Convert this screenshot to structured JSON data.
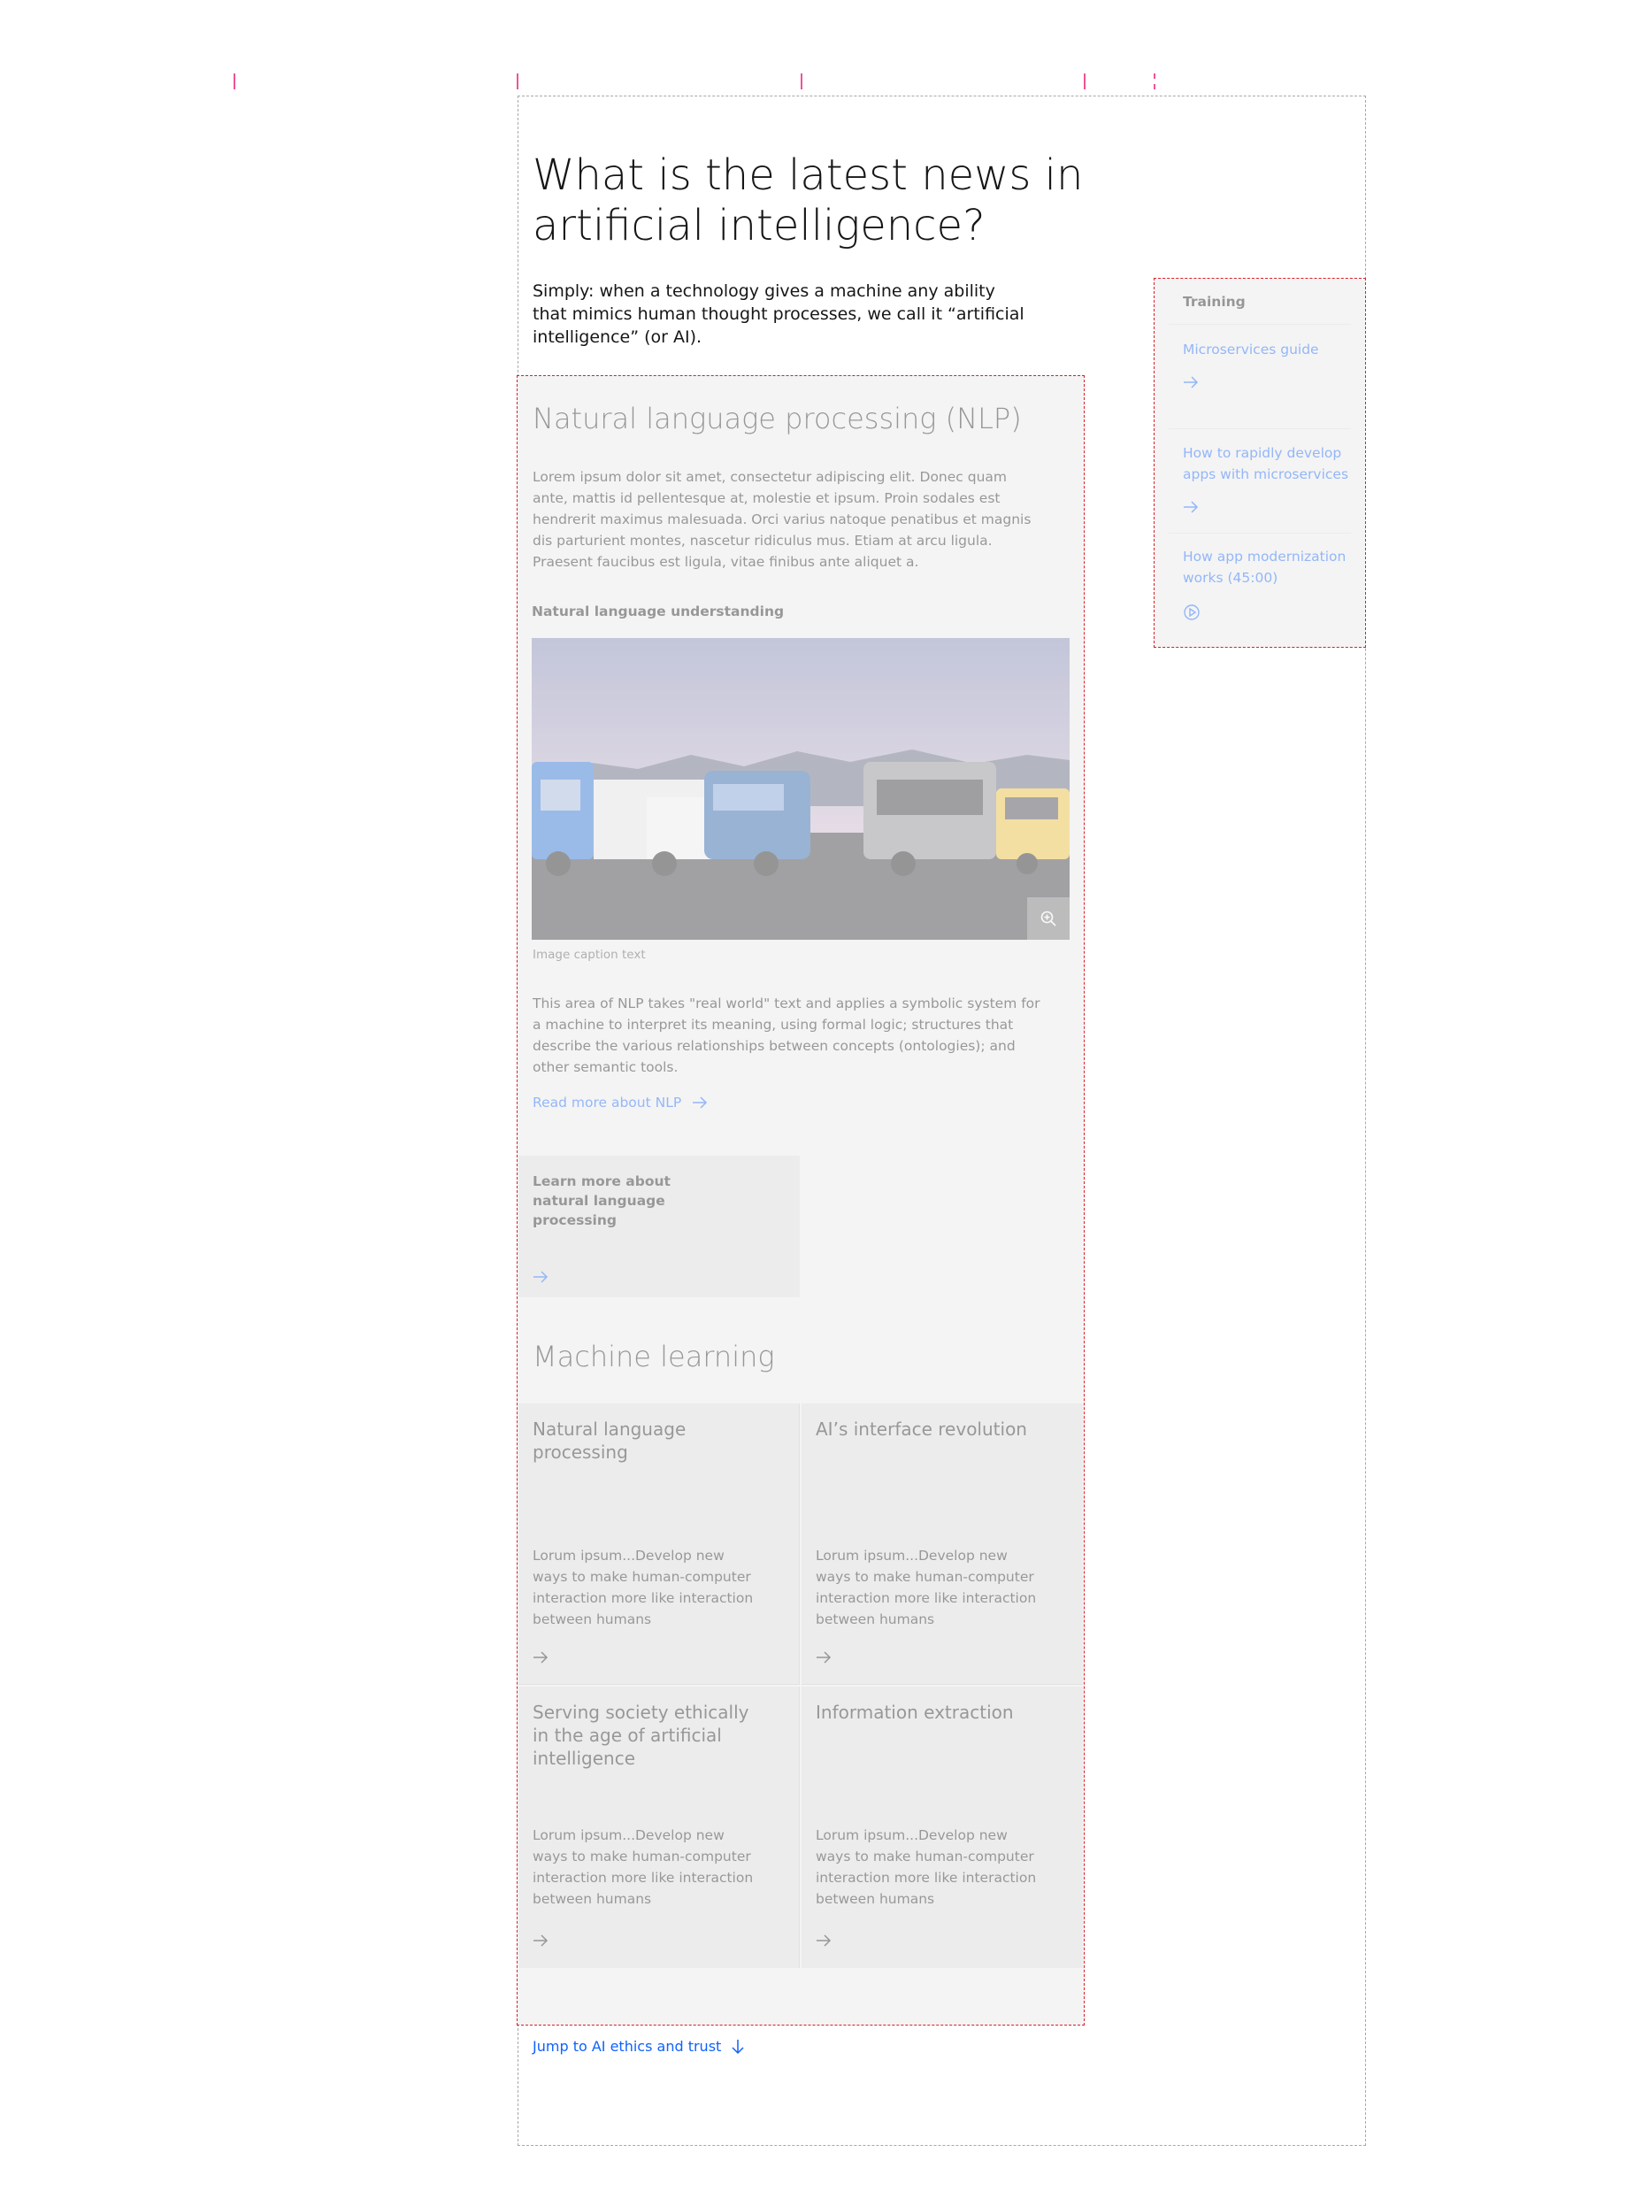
{
  "page": {
    "title": "What is the latest news in artificial intelligence?",
    "intro": "Simply: when a technology gives a machine any ability that mimics human thought processes, we call it “artificial intelligence” (or AI)."
  },
  "nlp": {
    "heading": "Natural language processing (NLP)",
    "body": "Lorem ipsum dolor sit amet, consectetur adipiscing elit. Donec quam ante, mattis id pellentesque at, molestie et ipsum. Proin sodales est hendrerit maximus malesuada. Orci varius natoque penatibus et magnis dis parturient montes, nascetur ridiculus mus. Etiam at arcu ligula. Praesent faucibus est ligula, vitae finibus ante aliquet a.",
    "subheading": "Natural language understanding",
    "image_caption": "Image caption text",
    "body2": "This area of NLP takes \"real world\" text and applies a symbolic system for a machine to interpret its meaning, using formal logic; structures that describe the various relationships between concepts (ontologies); and other semantic tools.",
    "link_label": "Read more about NLP",
    "cta_card_title": "Learn more about natural language processing"
  },
  "ml": {
    "heading": "Machine learning",
    "cards": [
      {
        "title": "Natural language processing",
        "desc": "Lorum ipsum...Develop new ways to make human-computer interaction more like interaction between humans"
      },
      {
        "title": "AI’s interface revolution",
        "desc": "Lorum ipsum...Develop new ways to make human-computer interaction more like interaction between humans"
      },
      {
        "title": "Serving society ethically in the age of artificial intelligence",
        "desc": "Lorum ipsum...Develop new ways to make human-computer interaction more like interaction between humans"
      },
      {
        "title": "Information extraction",
        "desc": "Lorum ipsum...Develop new ways to make human-computer interaction more like interaction between humans"
      }
    ]
  },
  "sidebar": {
    "heading": "Training",
    "items": [
      {
        "label": "Microservices guide",
        "icon": "arrow-right-icon"
      },
      {
        "label": "How to rapidly develop apps with microservices",
        "icon": "arrow-right-icon"
      },
      {
        "label": "How app modernization works (45:00)",
        "icon": "play-icon"
      }
    ]
  },
  "jump_link": {
    "label": "Jump to AI ethics and trust",
    "icon": "arrow-down-icon"
  },
  "colors": {
    "link": "#0f62fe",
    "guide": "#da1e28",
    "marker": "#ee5396",
    "panel": "#f4f4f4",
    "card": "#e0e0e0"
  }
}
